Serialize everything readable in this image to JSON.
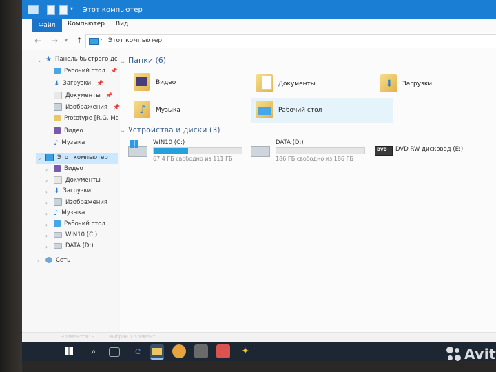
{
  "window": {
    "title": "Этот компьютер"
  },
  "ribbon": {
    "tabs": [
      "Файл",
      "Компьютер",
      "Вид"
    ]
  },
  "address": {
    "path": [
      "Этот компьютер"
    ]
  },
  "nav": {
    "quick_access": "Панель быстрого дс",
    "quick_items": [
      "Рабочий стол",
      "Загрузки",
      "Документы",
      "Изображения",
      "Prototype [R.G. Mec",
      "Видео",
      "Музыка"
    ],
    "this_pc": "Этот компьютер",
    "pc_items": [
      "Видео",
      "Документы",
      "Загрузки",
      "Изображения",
      "Музыка",
      "Рабочий стол",
      "WIN10 (C:)",
      "DATA (D:)"
    ],
    "network": "Сеть"
  },
  "content": {
    "folders_header": "Папки (6)",
    "folders": [
      "Видео",
      "Документы",
      "Загрузки",
      "Музыка",
      "Рабочий стол"
    ],
    "drives_header": "Устройства и диски (3)",
    "drives": [
      {
        "name": "WIN10 (C:)",
        "free": "67,4 ГБ свободно из 111 ГБ",
        "used_fraction": 0.39
      },
      {
        "name": "DATA (D:)",
        "free": "186 ГБ свободно из 186 ГБ",
        "used_fraction": 0.0
      },
      {
        "name": "DVD RW дисковод (E:)",
        "badge": "DVD"
      }
    ]
  },
  "status": {
    "items": "Элементов: 9",
    "selected": "Выбран 1 элемент"
  },
  "watermark": {
    "text": "Avito"
  },
  "colors": {
    "titlebar": "#1a7fd4",
    "selection": "#cce8ff",
    "taskbar": "#1c2733",
    "progress": "#26a0da"
  }
}
